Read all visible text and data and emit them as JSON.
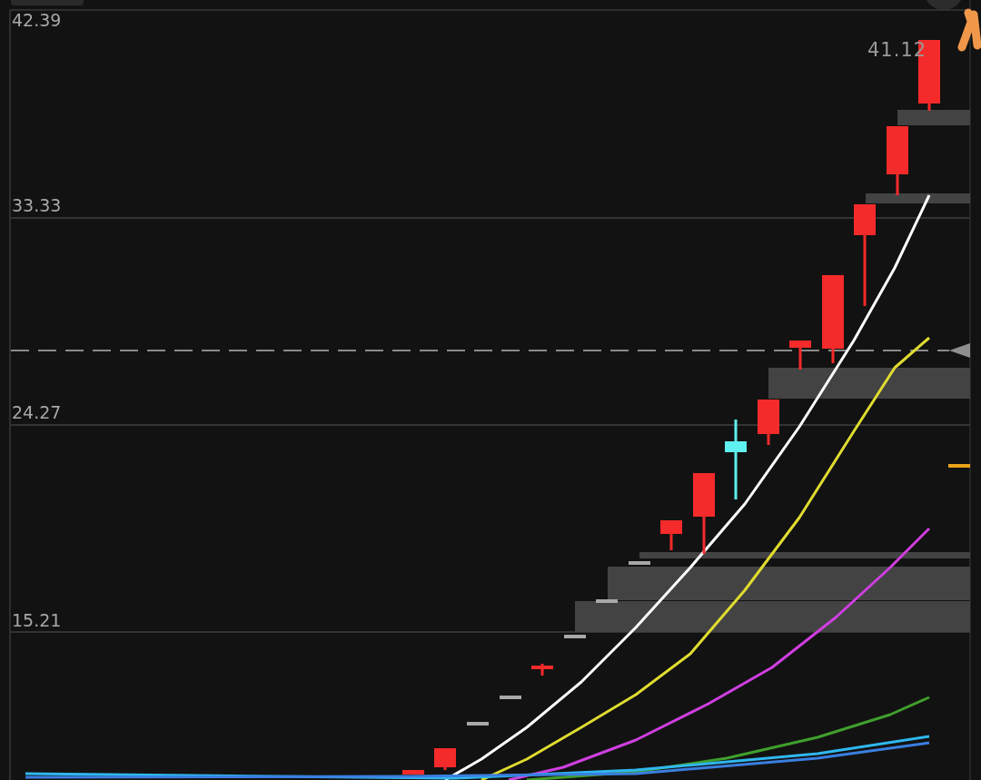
{
  "chart": {
    "price_axis_labels": [
      "42.39",
      "33.33",
      "24.27",
      "15.21"
    ],
    "high_price_label": "41.12"
  }
}
